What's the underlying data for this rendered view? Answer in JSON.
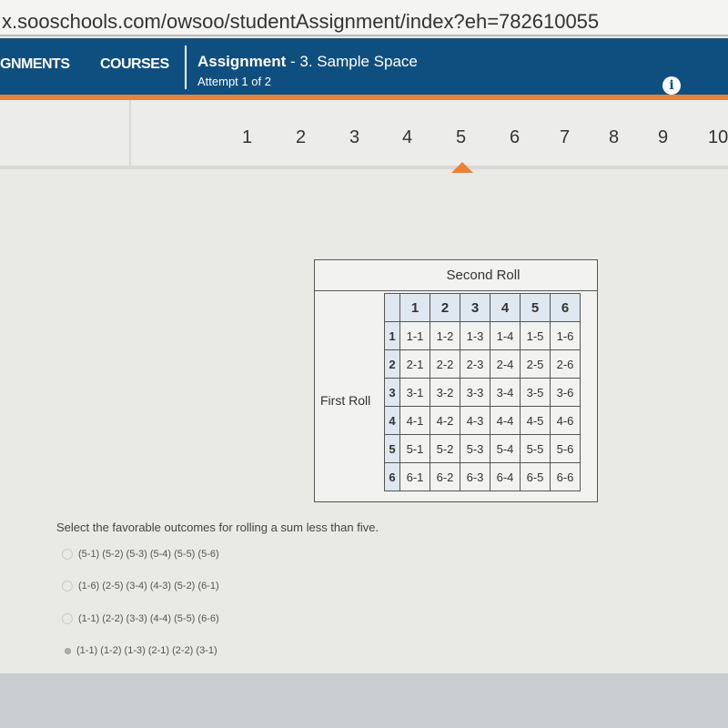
{
  "browser": {
    "url": "x.sooschools.com/owsoo/studentAssignment/index?eh=782610055"
  },
  "header": {
    "nav_assignments": "GNMENTS",
    "nav_courses": "COURSES",
    "assignment_label": "Assignment",
    "assignment_title": " - 3. Sample Space",
    "attempt": "Attempt 1 of 2",
    "info_icon": "i"
  },
  "questions": {
    "numbers": [
      "1",
      "2",
      "3",
      "4",
      "5",
      "6",
      "7",
      "8",
      "9",
      "10"
    ],
    "current": "5"
  },
  "sample_space": {
    "second_roll": "Second Roll",
    "first_roll": "First Roll",
    "col_headers": [
      "1",
      "2",
      "3",
      "4",
      "5",
      "6"
    ],
    "row_headers": [
      "1",
      "2",
      "3",
      "4",
      "5",
      "6"
    ],
    "cells": [
      [
        "1-1",
        "1-2",
        "1-3",
        "1-4",
        "1-5",
        "1-6"
      ],
      [
        "2-1",
        "2-2",
        "2-3",
        "2-4",
        "2-5",
        "2-6"
      ],
      [
        "3-1",
        "3-2",
        "3-3",
        "3-4",
        "3-5",
        "3-6"
      ],
      [
        "4-1",
        "4-2",
        "4-3",
        "4-4",
        "4-5",
        "4-6"
      ],
      [
        "5-1",
        "5-2",
        "5-3",
        "5-4",
        "5-5",
        "5-6"
      ],
      [
        "6-1",
        "6-2",
        "6-3",
        "6-4",
        "6-5",
        "6-6"
      ]
    ]
  },
  "question": {
    "prompt": "Select the favorable outcomes for rolling a sum less than five.",
    "options": [
      "(5-1) (5-2) (5-3) (5-4) (5-5) (5-6)",
      "(1-6) (2-5) (3-4) (4-3) (5-2) (6-1)",
      "(1-1) (2-2) (3-3) (4-4) (5-5) (6-6)",
      "(1-1) (1-2) (1-3) (2-1) (2-2) (3-1)"
    ],
    "selected_index": 3
  },
  "colors": {
    "header": "#0f4f7f",
    "accent": "#e8823a"
  }
}
